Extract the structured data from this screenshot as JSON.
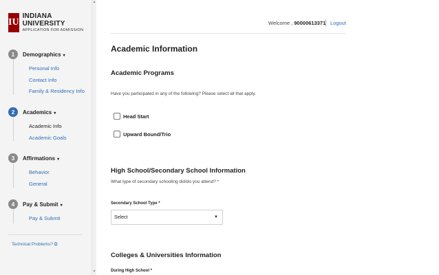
{
  "brand": {
    "mark": "IU",
    "title": "INDIANA UNIVERSITY",
    "subtitle": "APPLICATION FOR ADMISSION",
    "color": "#990000"
  },
  "sidebar": {
    "steps": [
      {
        "number": "1",
        "label": "Demographics",
        "active": false,
        "items": [
          "Personal Info",
          "Contact Info",
          "Family & Residency Info"
        ]
      },
      {
        "number": "2",
        "label": "Academics",
        "active": true,
        "items": [
          "Academic Info",
          "Academic Goals"
        ],
        "current": "Academic Info"
      },
      {
        "number": "3",
        "label": "Affirmations",
        "active": false,
        "items": [
          "Behavior",
          "General"
        ]
      },
      {
        "number": "4",
        "label": "Pay & Submit",
        "active": false,
        "items": [
          "Pay & Submit"
        ]
      }
    ],
    "tech_link": "Technical Problems?"
  },
  "header": {
    "welcome_prefix": "Welcome ,",
    "user_id": "90000613371",
    "logout": "Logout"
  },
  "main": {
    "title": "Academic Information",
    "academic_programs": {
      "heading": "Academic Programs",
      "question": "Have you participated in any of the following? Please select all that apply.",
      "options": [
        "Head Start",
        "Upward Bound/Trio"
      ]
    },
    "high_school": {
      "heading": "High School/Secondary School Information",
      "question": "What type of secondary schooling did/do you attend? *",
      "field_label": "Secondary School Type *",
      "selected": "Select"
    },
    "colleges": {
      "heading": "Colleges & Universities Information",
      "field_label": "During High School *"
    }
  },
  "colors": {
    "link": "#2f6db5",
    "active_step": "#2f6db5",
    "inactive_step": "#8a8a8a"
  }
}
